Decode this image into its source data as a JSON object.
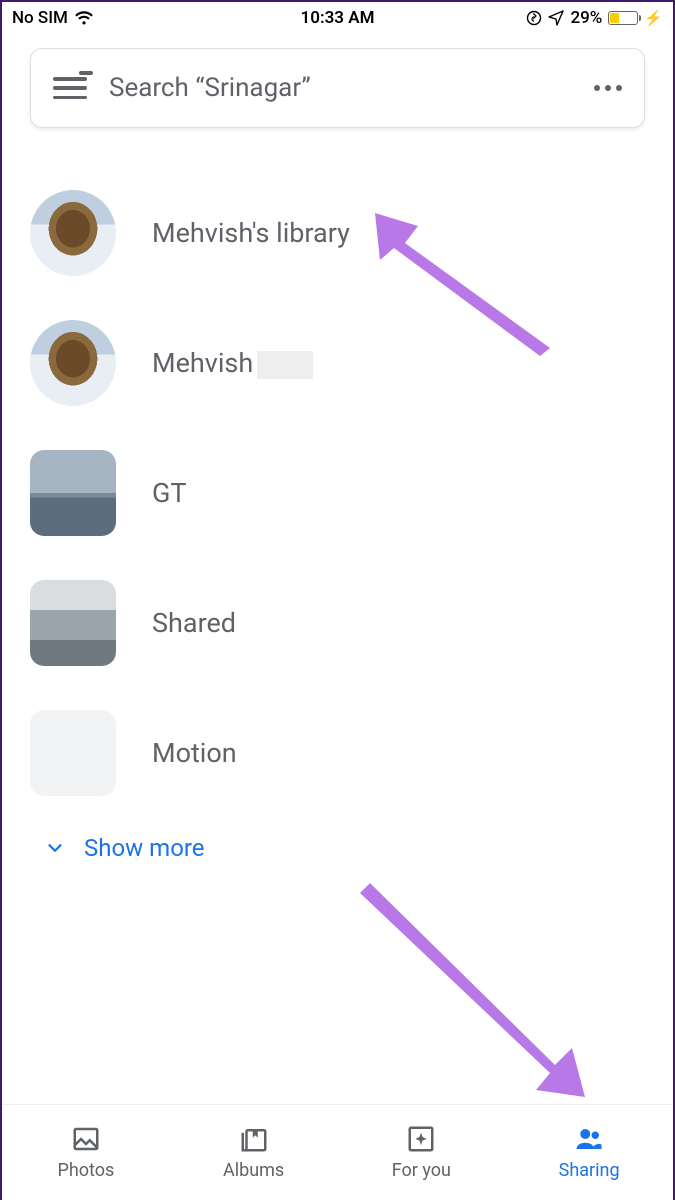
{
  "status": {
    "carrier": "No SIM",
    "time": "10:33 AM",
    "battery_pct": "29%"
  },
  "search": {
    "placeholder": "Search “Srinagar”"
  },
  "items": [
    {
      "label": "Mehvish's library",
      "shape": "round"
    },
    {
      "label": "Mehvish",
      "shape": "round",
      "redacted": true
    },
    {
      "label": "GT",
      "shape": "square"
    },
    {
      "label": "Shared",
      "shape": "square"
    },
    {
      "label": "Motion",
      "shape": "square"
    }
  ],
  "show_more": "Show more",
  "nav": {
    "photos": "Photos",
    "albums": "Albums",
    "for_you": "For you",
    "sharing": "Sharing"
  },
  "colors": {
    "accent": "#1a73e8",
    "arrow": "#b978e8",
    "text_muted": "#5f6368",
    "notif_dot": "#ea4335",
    "battery_fill": "#ffcc00"
  }
}
